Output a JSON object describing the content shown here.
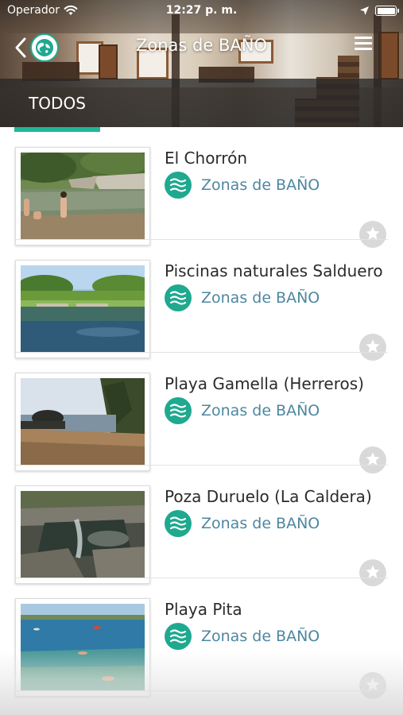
{
  "status_bar": {
    "carrier": "Operador",
    "time": "12:27 p. m.",
    "battery_level": 1.0,
    "icons": [
      "wifi-icon",
      "location-arrow-icon",
      "battery-icon"
    ]
  },
  "nav": {
    "title": "Zonas de BAÑO",
    "back_icon": "chevron-left-icon",
    "logo_icon": "globe-logo-icon",
    "menu_icon": "hamburger-menu-icon"
  },
  "tabs": [
    {
      "label": "TODOS",
      "active": true
    }
  ],
  "colors": {
    "accent": "#1fb896",
    "category_icon_bg": "#1fa98f",
    "category_text": "#4d87a0",
    "title_text": "#2b2b2b",
    "fav_bg": "#d9d9d9"
  },
  "items": [
    {
      "title": "El Chorrón",
      "category": "Zonas de BAÑO",
      "category_icon": "water-waves-icon",
      "fav_icon": "star-icon",
      "favorite": false
    },
    {
      "title": "Piscinas naturales Salduero",
      "category": "Zonas de BAÑO",
      "category_icon": "water-waves-icon",
      "fav_icon": "star-icon",
      "favorite": false
    },
    {
      "title": "Playa Gamella (Herreros)",
      "category": "Zonas de BAÑO",
      "category_icon": "water-waves-icon",
      "fav_icon": "star-icon",
      "favorite": false
    },
    {
      "title": "Poza Duruelo (La Caldera)",
      "category": "Zonas de BAÑO",
      "category_icon": "water-waves-icon",
      "fav_icon": "star-icon",
      "favorite": false
    },
    {
      "title": "Playa Pita",
      "category": "Zonas de BAÑO",
      "category_icon": "water-waves-icon",
      "fav_icon": "star-icon",
      "favorite": false
    }
  ]
}
